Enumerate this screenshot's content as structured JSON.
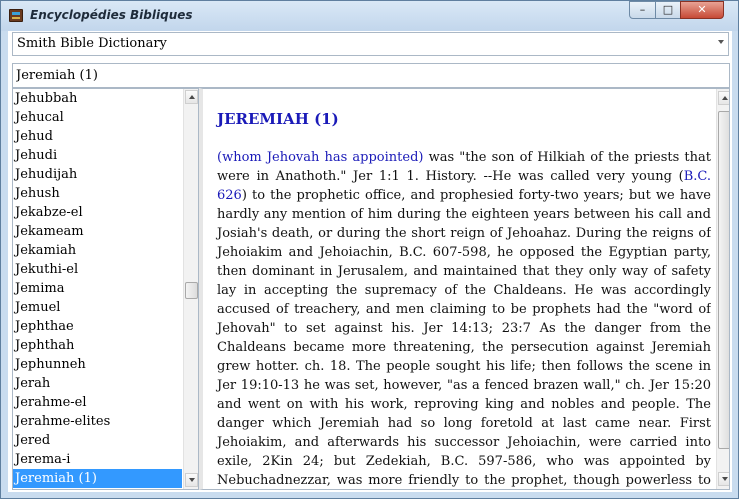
{
  "window": {
    "title": "Encyclopédies Bibliques",
    "controls": {
      "minimize": "–",
      "maximize": "□",
      "close": "✕"
    }
  },
  "dictionary_select": {
    "selected": "Smith Bible Dictionary"
  },
  "search": {
    "value": "Jeremiah (1)"
  },
  "word_list": {
    "items": [
      "Jehubbah",
      "Jehucal",
      "Jehud",
      "Jehudi",
      "Jehudijah",
      "Jehush",
      "Jekabze-el",
      "Jekameam",
      "Jekamiah",
      "Jekuthi-el",
      "Jemima",
      "Jemuel",
      "Jephthae",
      "Jephthah",
      "Jephunneh",
      "Jerah",
      "Jerahme-el",
      "Jerahme-elites",
      "Jered",
      "Jerema-i",
      "Jeremiah (1)"
    ],
    "selected": "Jeremiah (1)"
  },
  "article": {
    "title": "JEREMIAH (1)",
    "meaning_link": "(whom Jehovah has appointed)",
    "text1": " was \"the son of Hilkiah of the priests that were in Anathoth.\" Jer 1:1 1. History. --He was called very young (",
    "date_link": "B.C. 626",
    "text2": ") to the prophetic office, and prophesied forty-two years; but we have hardly any mention of him during the eighteen years between his call and Josiah's death, or during the short reign of Jehoahaz. During the reigns of Jehoiakim and Jehoiachin, B.C. 607-598, he opposed the Egyptian party, then dominant in Jerusalem, and maintained that they only way of safety lay in accepting the supremacy of the Chaldeans. He was accordingly accused of treachery, and men claiming to be prophets had the \"word of Jehovah\" to set against his. Jer 14:13; 23:7 As the danger from the Chaldeans became more threatening, the persecution against Jeremiah grew hotter. ch. 18. The people sought his life; then follows the scene in Jer 19:10-13 he was set, however, \"as a fenced brazen wall,\" ch. Jer 15:20 and went on with his work, reproving king and nobles and people. The danger which Jeremiah had so long foretold at last came near. First Jehoiakim, and afterwards his successor Jehoiachin, were carried into exile, 2Kin 24; but Zedekiah, B.C. 597-586, who was appointed by Nebuchadnezzar, was more friendly to the prophet, though powerless to help him. The approach of an Egyptian army"
  },
  "colors": {
    "link": "#1a1ab8",
    "selection": "#3399ff",
    "window_frame": "#c9dcef"
  }
}
